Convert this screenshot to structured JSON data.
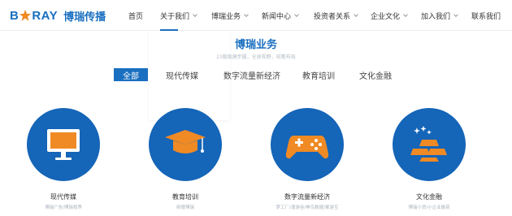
{
  "logo": {
    "en": "B RAY",
    "cn": "博瑞传播"
  },
  "nav": [
    {
      "label": "首页",
      "has_dropdown": false
    },
    {
      "label": "关于我们",
      "has_dropdown": true
    },
    {
      "label": "博瑞业务",
      "has_dropdown": true
    },
    {
      "label": "新闻中心",
      "has_dropdown": true
    },
    {
      "label": "投资者关系",
      "has_dropdown": true
    },
    {
      "label": "企业文化",
      "has_dropdown": true
    },
    {
      "label": "加入我们",
      "has_dropdown": true
    },
    {
      "label": "联系我们",
      "has_dropdown": false
    }
  ],
  "dropdown": {
    "items": [
      "",
      "",
      "",
      "",
      "",
      ""
    ]
  },
  "section": {
    "title": "博瑞业务",
    "subtitle": "23载稳健步履，全球视野，前瞻布局"
  },
  "tabs": [
    {
      "label": "全部",
      "active": true
    },
    {
      "label": "现代传媒",
      "active": false
    },
    {
      "label": "数字流量新经济",
      "active": false
    },
    {
      "label": "教育培训",
      "active": false
    },
    {
      "label": "文化金融",
      "active": false
    }
  ],
  "cards": [
    {
      "name": "现代传媒",
      "desc": "博瑞广告/博瑞视界",
      "icon": "monitor-icon"
    },
    {
      "name": "教育培训",
      "desc": "树德博瑞",
      "icon": "graduation-cap-icon"
    },
    {
      "name": "数字流量新经济",
      "desc": "梦工厂/漫游谷/神鸟数据/紫游互",
      "icon": "gamepad-icon"
    },
    {
      "name": "文化金融",
      "desc": "博瑞小贷/小企业融资",
      "icon": "gold-bars-icon"
    }
  ],
  "colors": {
    "brand": "#1a6fc0",
    "circle": "#1565b8",
    "icon_orange": "#f08a24"
  }
}
